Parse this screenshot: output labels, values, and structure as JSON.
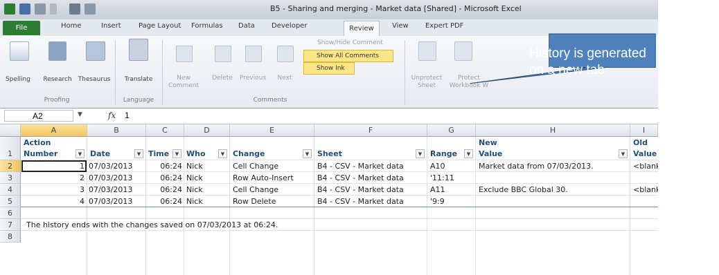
{
  "window": {
    "title": "B5 - Sharing and merging - Market data  [Shared] - Microsoft Excel"
  },
  "tabs": [
    {
      "label": "File"
    },
    {
      "label": "Home"
    },
    {
      "label": "Insert"
    },
    {
      "label": "Page Layout"
    },
    {
      "label": "Formulas"
    },
    {
      "label": "Data"
    },
    {
      "label": "Developer"
    },
    {
      "label": "Review"
    },
    {
      "label": "View"
    },
    {
      "label": "Expert PDF"
    }
  ],
  "ribbon": {
    "proofing": {
      "spelling": "Spelling",
      "research": "Research",
      "thesaurus": "Thesaurus",
      "group": "Proofing"
    },
    "language": {
      "translate": "Translate",
      "group": "Language"
    },
    "comments": {
      "new": "New",
      "new2": "Comment",
      "delete": "Delete",
      "previous": "Previous",
      "next": "Next",
      "show_hide": "Show/Hide Comment",
      "show_all": "Show All Comments",
      "show_ink": "Show Ink",
      "group": "Comments"
    },
    "changes": {
      "unprotect": "Unprotect",
      "unprotect2": "Sheet",
      "protect": "Protect",
      "protect2": "Workbook W"
    }
  },
  "formula_bar": {
    "name_box": "A2",
    "fx": "fx",
    "value": "1"
  },
  "grid": {
    "columns": [
      "A",
      "B",
      "C",
      "D",
      "E",
      "F",
      "G",
      "H",
      "I"
    ],
    "rows": [
      "1",
      "2",
      "3",
      "4",
      "5",
      "6",
      "7",
      "8"
    ],
    "headers": {
      "action": "Action",
      "number": "Number",
      "date": "Date",
      "time": "Time",
      "who": "Who",
      "change": "Change",
      "sheet": "Sheet",
      "range": "Range",
      "new": "New",
      "new_value": "Value",
      "old": "Old",
      "old_value": "Value"
    },
    "records": [
      {
        "num": "1",
        "date": "07/03/2013",
        "time": "06:24",
        "who": "Nick",
        "change": "Cell Change",
        "sheet": "B4 - CSV - Market data",
        "range": "A10",
        "new": "Market data from 07/03/2013.",
        "old": "<blank"
      },
      {
        "num": "2",
        "date": "07/03/2013",
        "time": "06:24",
        "who": "Nick",
        "change": "Row Auto-Insert",
        "sheet": "B4 - CSV - Market data",
        "range": "'11:11",
        "new": "",
        "old": ""
      },
      {
        "num": "3",
        "date": "07/03/2013",
        "time": "06:24",
        "who": "Nick",
        "change": "Cell Change",
        "sheet": "B4 - CSV - Market data",
        "range": "A11",
        "new": "Exclude BBC Global 30.",
        "old": "<blank"
      },
      {
        "num": "4",
        "date": "07/03/2013",
        "time": "06:24",
        "who": "Nick",
        "change": "Row Delete",
        "sheet": "B4 - CSV - Market data",
        "range": "'9:9",
        "new": "",
        "old": ""
      }
    ],
    "footer": "The history ends with the changes saved on 07/03/2013 at 06:24."
  },
  "callout": {
    "line1": "History is generated",
    "line2": "on a new tab"
  },
  "colors": {
    "file_tab": "#2d7c33",
    "callout_fill": "#4f81bd",
    "callout_border": "#2c4d75",
    "header_text": "#1f4e79",
    "highlight": "#fde58a"
  }
}
